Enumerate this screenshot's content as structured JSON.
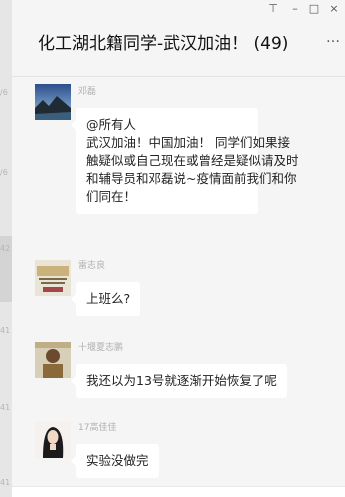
{
  "window": {
    "title": "化工湖北籍同学-武汉加油！ (49)",
    "controls": {
      "pin": "⊤",
      "minimize": "–",
      "maximize": "□",
      "close": "×"
    },
    "more": "…"
  },
  "left_strip": {
    "items": [
      "/6",
      "/6",
      "42",
      "41",
      "41",
      "41"
    ]
  },
  "messages": [
    {
      "sender": "邓磊",
      "avatar": "landscape-avatar",
      "lines": [
        "@所有人",
        "武汉加油！中国加油！ 同学们如果接",
        "触疑似或自己现在或曾经是疑似请及时",
        "和辅导员和邓磊说~疫情面前我们和你",
        "们同在！"
      ]
    },
    {
      "sender": "雷志良",
      "avatar": "poster-avatar",
      "lines": [
        "上班么?"
      ]
    },
    {
      "sender": "十堰夏志鹏",
      "avatar": "photo-avatar",
      "lines": [
        "我还以为13号就逐渐开始恢复了呢"
      ]
    },
    {
      "sender": "17高佳佳",
      "avatar": "portrait-avatar",
      "lines": [
        "实验没做完"
      ]
    }
  ]
}
